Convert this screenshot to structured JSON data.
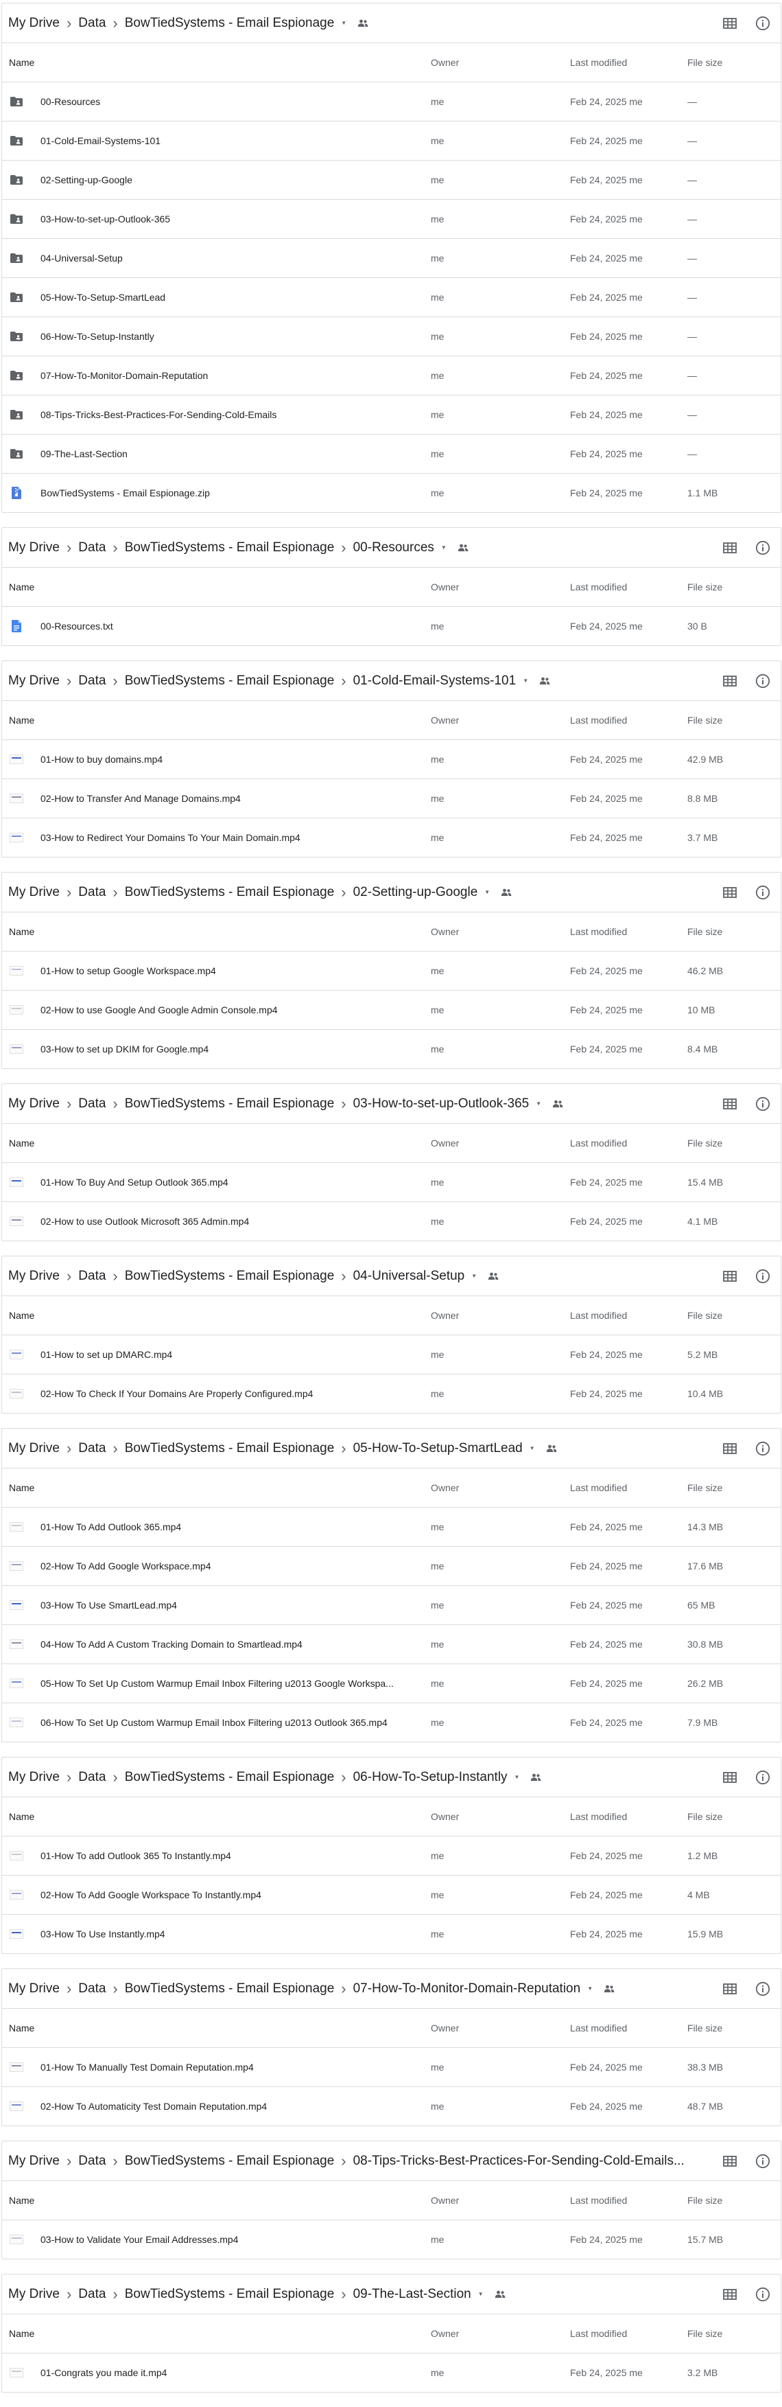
{
  "icons": {
    "grid": "grid-view-icon",
    "info": "info-icon",
    "folder": "shared-folder-icon",
    "zip": "zip-icon",
    "txt": "text-doc-icon",
    "video": "video-thumbnail-icon",
    "people": "people-icon"
  },
  "columns": {
    "name": "Name",
    "owner": "Owner",
    "modified": "Last modified",
    "size": "File size"
  },
  "panels": [
    {
      "crumbs": [
        "My Drive",
        "Data",
        "BowTiedSystems - Email Espionage"
      ],
      "rows": [
        {
          "type": "folder",
          "name": "00-Resources",
          "owner": "me",
          "modified": "Feb 24, 2025 me",
          "size": "—"
        },
        {
          "type": "folder",
          "name": "01-Cold-Email-Systems-101",
          "owner": "me",
          "modified": "Feb 24, 2025 me",
          "size": "—"
        },
        {
          "type": "folder",
          "name": "02-Setting-up-Google",
          "owner": "me",
          "modified": "Feb 24, 2025 me",
          "size": "—"
        },
        {
          "type": "folder",
          "name": "03-How-to-set-up-Outlook-365",
          "owner": "me",
          "modified": "Feb 24, 2025 me",
          "size": "—"
        },
        {
          "type": "folder",
          "name": "04-Universal-Setup",
          "owner": "me",
          "modified": "Feb 24, 2025 me",
          "size": "—"
        },
        {
          "type": "folder",
          "name": "05-How-To-Setup-SmartLead",
          "owner": "me",
          "modified": "Feb 24, 2025 me",
          "size": "—"
        },
        {
          "type": "folder",
          "name": "06-How-To-Setup-Instantly",
          "owner": "me",
          "modified": "Feb 24, 2025 me",
          "size": "—"
        },
        {
          "type": "folder",
          "name": "07-How-To-Monitor-Domain-Reputation",
          "owner": "me",
          "modified": "Feb 24, 2025 me",
          "size": "—"
        },
        {
          "type": "folder",
          "name": "08-Tips-Tricks-Best-Practices-For-Sending-Cold-Emails",
          "owner": "me",
          "modified": "Feb 24, 2025 me",
          "size": "—"
        },
        {
          "type": "folder",
          "name": "09-The-Last-Section",
          "owner": "me",
          "modified": "Feb 24, 2025 me",
          "size": "—"
        },
        {
          "type": "zip",
          "name": "BowTiedSystems - Email Espionage.zip",
          "owner": "me",
          "modified": "Feb 24, 2025 me",
          "size": "1.1 MB"
        }
      ]
    },
    {
      "crumbs": [
        "My Drive",
        "Data",
        "BowTiedSystems - Email Espionage",
        "00-Resources"
      ],
      "rows": [
        {
          "type": "txt",
          "name": "00-Resources.txt",
          "owner": "me",
          "modified": "Feb 24, 2025 me",
          "size": "30 B"
        }
      ]
    },
    {
      "crumbs": [
        "My Drive",
        "Data",
        "BowTiedSystems - Email Espionage",
        "01-Cold-Email-Systems-101"
      ],
      "rows": [
        {
          "type": "video",
          "name": "01-How to buy domains.mp4",
          "owner": "me",
          "modified": "Feb 24, 2025 me",
          "size": "42.9 MB"
        },
        {
          "type": "video",
          "name": "02-How to Transfer And Manage Domains.mp4",
          "owner": "me",
          "modified": "Feb 24, 2025 me",
          "size": "8.8 MB"
        },
        {
          "type": "video",
          "name": "03-How to Redirect Your Domains To Your Main Domain.mp4",
          "owner": "me",
          "modified": "Feb 24, 2025 me",
          "size": "3.7 MB"
        }
      ]
    },
    {
      "crumbs": [
        "My Drive",
        "Data",
        "BowTiedSystems - Email Espionage",
        "02-Setting-up-Google"
      ],
      "rows": [
        {
          "type": "video",
          "name": "01-How to setup Google Workspace.mp4",
          "owner": "me",
          "modified": "Feb 24, 2025 me",
          "size": "46.2 MB"
        },
        {
          "type": "video",
          "name": "02-How to use Google And Google Admin Console.mp4",
          "owner": "me",
          "modified": "Feb 24, 2025 me",
          "size": "10 MB"
        },
        {
          "type": "video",
          "name": "03-How to set up DKIM for Google.mp4",
          "owner": "me",
          "modified": "Feb 24, 2025 me",
          "size": "8.4 MB"
        }
      ]
    },
    {
      "crumbs": [
        "My Drive",
        "Data",
        "BowTiedSystems - Email Espionage",
        "03-How-to-set-up-Outlook-365"
      ],
      "rows": [
        {
          "type": "video",
          "name": "01-How To Buy And Setup Outlook 365.mp4",
          "owner": "me",
          "modified": "Feb 24, 2025 me",
          "size": "15.4 MB"
        },
        {
          "type": "video",
          "name": "02-How to use Outlook Microsoft 365 Admin.mp4",
          "owner": "me",
          "modified": "Feb 24, 2025 me",
          "size": "4.1 MB"
        }
      ]
    },
    {
      "crumbs": [
        "My Drive",
        "Data",
        "BowTiedSystems - Email Espionage",
        "04-Universal-Setup"
      ],
      "rows": [
        {
          "type": "video",
          "name": "01-How to set up DMARC.mp4",
          "owner": "me",
          "modified": "Feb 24, 2025 me",
          "size": "5.2 MB"
        },
        {
          "type": "video",
          "name": "02-How To Check If Your Domains Are Properly Configured.mp4",
          "owner": "me",
          "modified": "Feb 24, 2025 me",
          "size": "10.4 MB"
        }
      ]
    },
    {
      "crumbs": [
        "My Drive",
        "Data",
        "BowTiedSystems - Email Espionage",
        "05-How-To-Setup-SmartLead"
      ],
      "rows": [
        {
          "type": "video",
          "name": "01-How To Add Outlook 365.mp4",
          "owner": "me",
          "modified": "Feb 24, 2025 me",
          "size": "14.3 MB"
        },
        {
          "type": "video",
          "name": "02-How To Add Google Workspace.mp4",
          "owner": "me",
          "modified": "Feb 24, 2025 me",
          "size": "17.6 MB"
        },
        {
          "type": "video",
          "name": "03-How To Use SmartLead.mp4",
          "owner": "me",
          "modified": "Feb 24, 2025 me",
          "size": "65 MB"
        },
        {
          "type": "video",
          "name": "04-How To Add A Custom Tracking Domain to Smartlead.mp4",
          "owner": "me",
          "modified": "Feb 24, 2025 me",
          "size": "30.8 MB"
        },
        {
          "type": "video",
          "name": "05-How To Set Up Custom Warmup Email Inbox Filtering u2013 Google Workspa...",
          "owner": "me",
          "modified": "Feb 24, 2025 me",
          "size": "26.2 MB"
        },
        {
          "type": "video",
          "name": "06-How To Set Up Custom Warmup Email Inbox Filtering u2013 Outlook 365.mp4",
          "owner": "me",
          "modified": "Feb 24, 2025 me",
          "size": "7.9 MB"
        }
      ]
    },
    {
      "crumbs": [
        "My Drive",
        "Data",
        "BowTiedSystems - Email Espionage",
        "06-How-To-Setup-Instantly"
      ],
      "rows": [
        {
          "type": "video",
          "name": "01-How To add Outlook 365 To Instantly.mp4",
          "owner": "me",
          "modified": "Feb 24, 2025 me",
          "size": "1.2 MB"
        },
        {
          "type": "video",
          "name": "02-How To Add Google Workspace To Instantly.mp4",
          "owner": "me",
          "modified": "Feb 24, 2025 me",
          "size": "4 MB"
        },
        {
          "type": "video",
          "name": "03-How To Use Instantly.mp4",
          "owner": "me",
          "modified": "Feb 24, 2025 me",
          "size": "15.9 MB"
        }
      ]
    },
    {
      "crumbs": [
        "My Drive",
        "Data",
        "BowTiedSystems - Email Espionage",
        "07-How-To-Monitor-Domain-Reputation"
      ],
      "rows": [
        {
          "type": "video",
          "name": "01-How To Manually Test Domain Reputation.mp4",
          "owner": "me",
          "modified": "Feb 24, 2025 me",
          "size": "38.3 MB"
        },
        {
          "type": "video",
          "name": "02-How To Automaticity Test Domain Reputation.mp4",
          "owner": "me",
          "modified": "Feb 24, 2025 me",
          "size": "48.7 MB"
        }
      ]
    },
    {
      "crumbs": [
        "My Drive",
        "Data",
        "BowTiedSystems - Email Espionage",
        "08-Tips-Tricks-Best-Practices-For-Sending-Cold-Emails..."
      ],
      "truncated": true,
      "rows": [
        {
          "type": "video",
          "name": "03-How to Validate Your Email Addresses.mp4",
          "owner": "me",
          "modified": "Feb 24, 2025 me",
          "size": "15.7 MB"
        }
      ]
    },
    {
      "crumbs": [
        "My Drive",
        "Data",
        "BowTiedSystems - Email Espionage",
        "09-The-Last-Section"
      ],
      "rows": [
        {
          "type": "video",
          "name": "01-Congrats you made it.mp4",
          "owner": "me",
          "modified": "Feb 24, 2025 me",
          "size": "3.2 MB"
        }
      ]
    }
  ]
}
